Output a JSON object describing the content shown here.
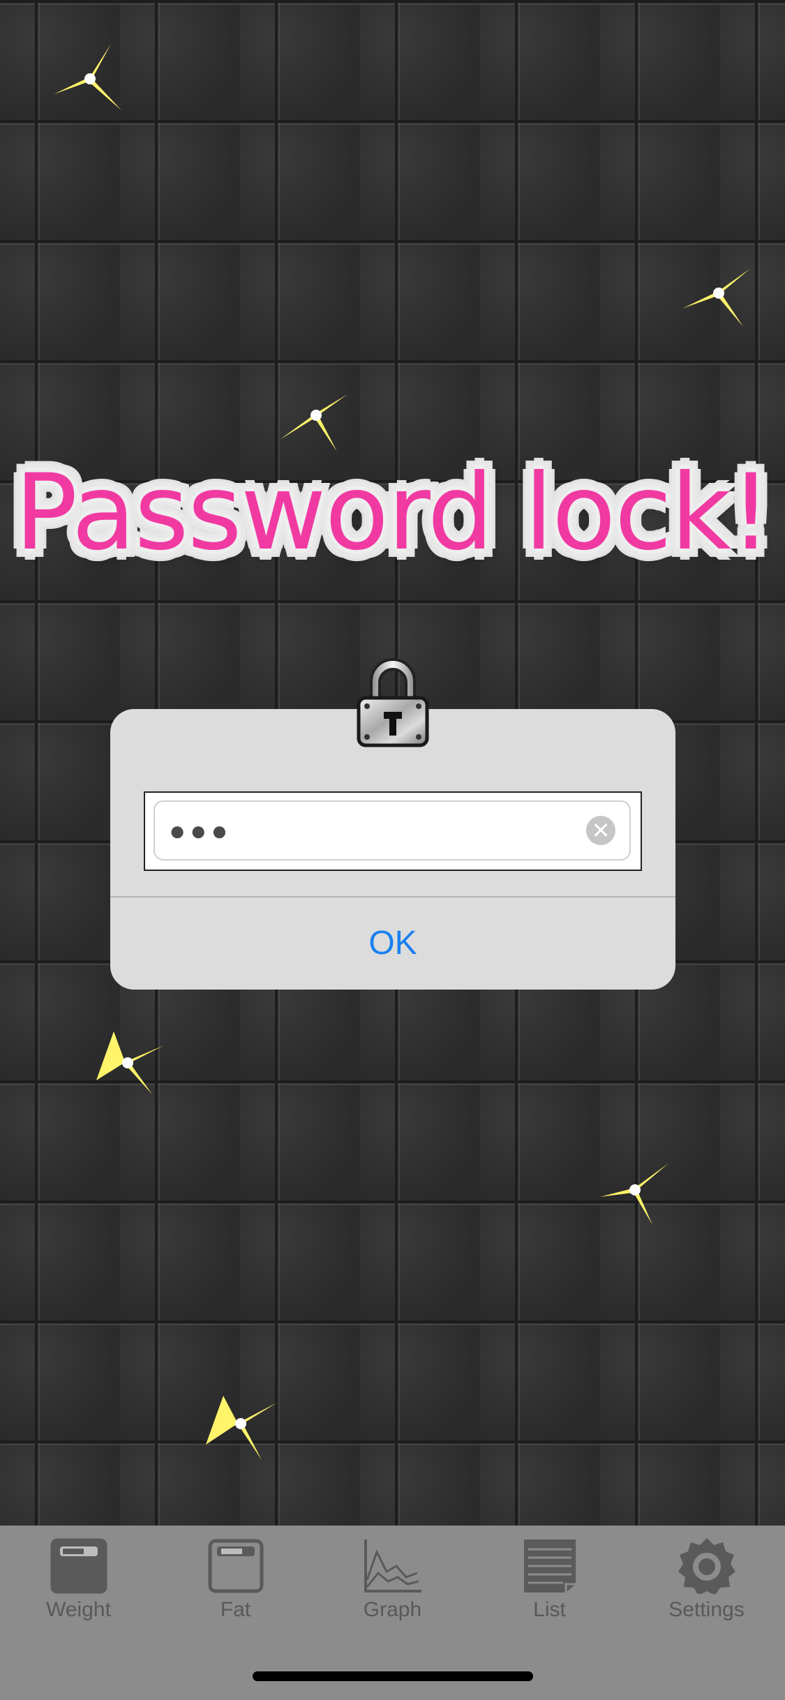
{
  "title": "Password lock!",
  "dialog": {
    "password_mask": "●●●",
    "ok_label": "OK"
  },
  "tabs": [
    {
      "label": "Weight",
      "icon": "scale-icon"
    },
    {
      "label": "Fat",
      "icon": "body-fat-scale-icon"
    },
    {
      "label": "Graph",
      "icon": "graph-icon"
    },
    {
      "label": "List",
      "icon": "list-icon"
    },
    {
      "label": "Settings",
      "icon": "gear-icon"
    }
  ],
  "colors": {
    "title": "#f03aa2",
    "ok": "#1a80f0",
    "sparkle": "#fff36b"
  }
}
